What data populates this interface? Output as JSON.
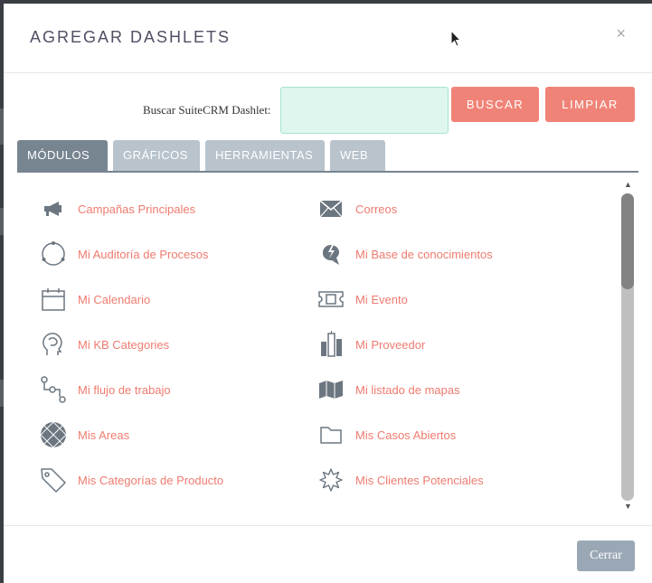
{
  "modal": {
    "title": "AGREGAR DASHLETS",
    "close_glyph": "×"
  },
  "search": {
    "label": "Buscar SuiteCRM Dashlet:",
    "value": "",
    "search_button": "BUSCAR",
    "clear_button": "LIMPIAR"
  },
  "tabs": [
    {
      "label": "MÓDULOS",
      "active": true
    },
    {
      "label": "GRÁFICOS",
      "active": false
    },
    {
      "label": "HERRAMIENTAS",
      "active": false
    },
    {
      "label": "WEB",
      "active": false
    }
  ],
  "dashlets": [
    {
      "label": "Campañas Principales",
      "icon": "megaphone-icon"
    },
    {
      "label": "Correos",
      "icon": "envelope-icon"
    },
    {
      "label": "Mi Auditoría de Procesos",
      "icon": "process-audit-icon"
    },
    {
      "label": "Mi Base de conocimientos",
      "icon": "knowledge-base-icon"
    },
    {
      "label": "Mi Calendario",
      "icon": "calendar-icon"
    },
    {
      "label": "Mi Evento",
      "icon": "ticket-icon"
    },
    {
      "label": "Mi KB Categories",
      "icon": "head-icon"
    },
    {
      "label": "Mi Proveedor",
      "icon": "buildings-icon"
    },
    {
      "label": "Mi flujo de trabajo",
      "icon": "workflow-icon"
    },
    {
      "label": "Mi listado de mapas",
      "icon": "map-icon"
    },
    {
      "label": "Mis Areas",
      "icon": "globe-grid-icon"
    },
    {
      "label": "Mis Casos Abiertos",
      "icon": "folder-icon"
    },
    {
      "label": "Mis Categorías de Producto",
      "icon": "tag-icon"
    },
    {
      "label": "Mis Clientes Potenciales",
      "icon": "starburst-icon"
    }
  ],
  "footer": {
    "close_button": "Cerrar"
  },
  "colors": {
    "accent": "#f08377",
    "link": "#ef7b6f",
    "tab_active": "#778591",
    "tab_inactive": "#b8c3cc",
    "search_bg": "#dff6ef",
    "icon": "#6b7680"
  }
}
